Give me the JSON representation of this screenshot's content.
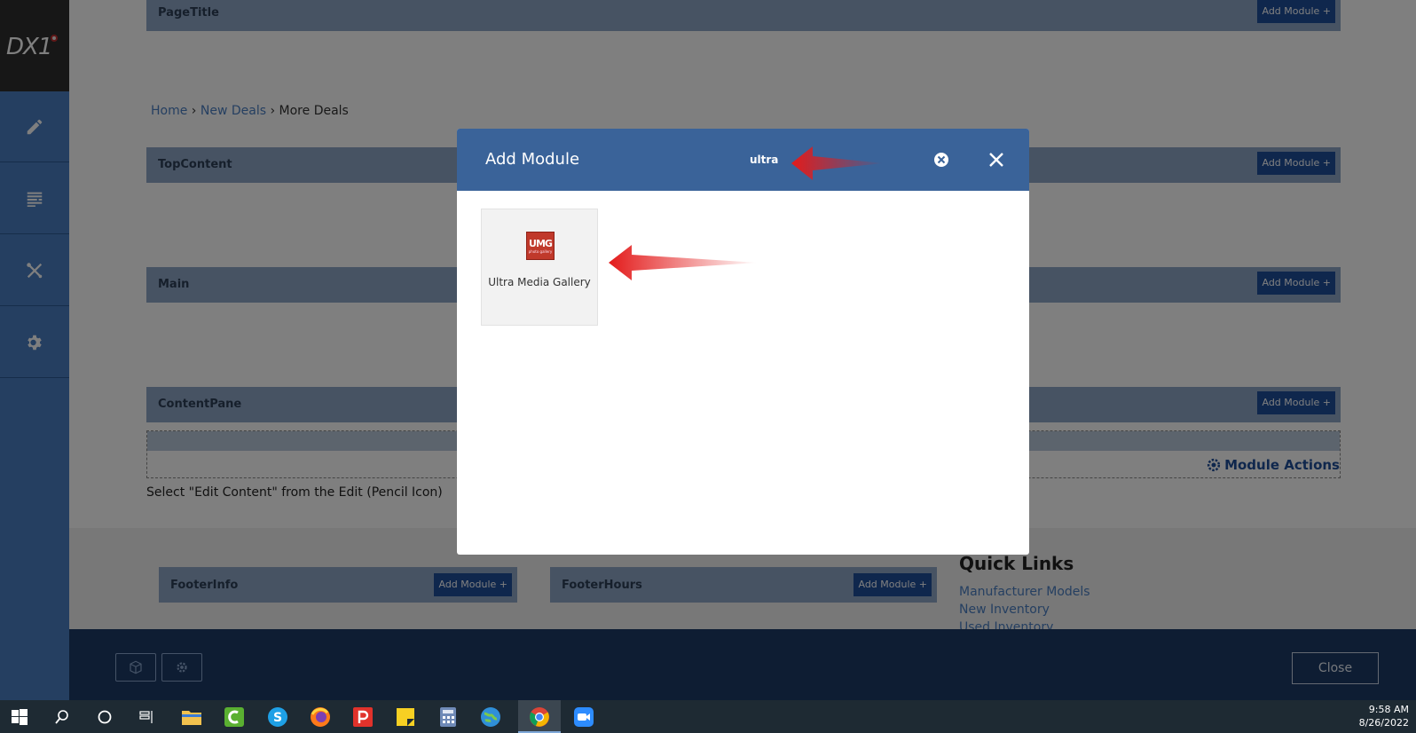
{
  "sidebar": {
    "logo_text": "DX1",
    "buttons": [
      "pencil-icon",
      "layout-icon",
      "tools-icon",
      "gear-icon"
    ]
  },
  "page": {
    "panes": {
      "page_title": "PageTitle",
      "top_content": "TopContent",
      "main": "Main",
      "content_pane": "ContentPane"
    },
    "add_module_label": "Add Module +",
    "breadcrumb": {
      "home": "Home",
      "sep1": "›",
      "new_deals": "New Deals",
      "sep2": "›",
      "current": "More Deals"
    },
    "module_actions": "Module Actions",
    "instruction": "Select \"Edit Content\" from the Edit (Pencil Icon)",
    "footer": {
      "footer_info": "FooterInfo",
      "footer_hours": "FooterHours",
      "quick_links_title": "Quick Links",
      "quick_links": [
        "Manufacturer Models",
        "New Inventory",
        "Used Inventory"
      ]
    },
    "bottom_bar": {
      "close_label": "Close"
    }
  },
  "modal": {
    "title": "Add Module",
    "search_value": "ultra",
    "results": [
      {
        "icon_text": "UMG",
        "icon_sub": "photo gallery",
        "name": "Ultra Media Gallery"
      }
    ]
  },
  "taskbar": {
    "time": "9:58 AM",
    "date": "8/26/2022",
    "apps": [
      "start-icon",
      "search-icon",
      "cortana-icon",
      "task-view-icon",
      "file-explorer-icon",
      "camtasia-icon",
      "skype-icon",
      "firefox-icon",
      "pocketcasts-icon",
      "sticky-notes-icon",
      "calculator-icon",
      "earth-icon",
      "chrome-icon",
      "zoom-icon"
    ]
  },
  "colors": {
    "sidebar": "#4a7ec2",
    "modal_header": "#3a6399",
    "add_module_button": "#1f4e9a",
    "arrow": "#e31b1b"
  }
}
